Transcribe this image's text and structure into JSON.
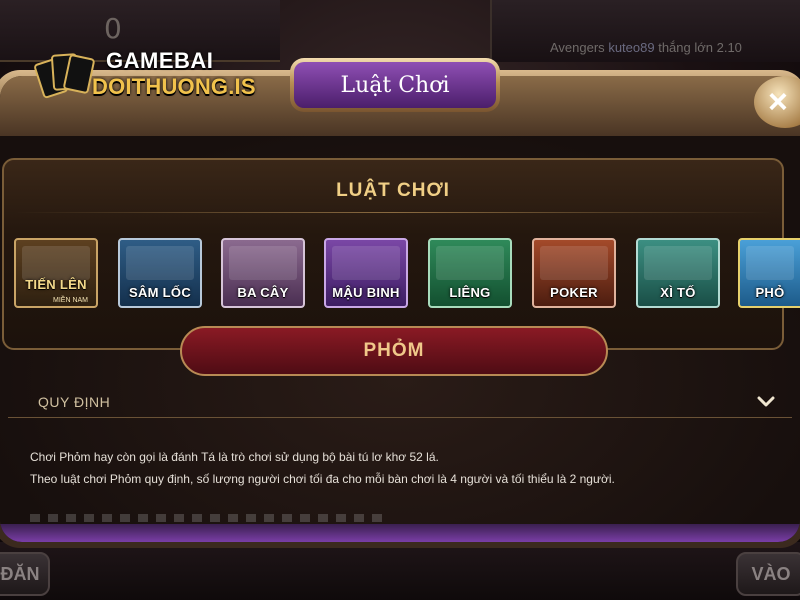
{
  "background": {
    "counter": "0",
    "ticker": {
      "user_prefix": "Avengers",
      "username": "kuteo89",
      "text": "thắng lớn 2.10"
    },
    "bottom_left_button": "ĐĂN",
    "bottom_right_button": "VÀO"
  },
  "logo": {
    "line1": "GAMEBAI",
    "line2": "DOITHUONG.IS"
  },
  "modal": {
    "title": "Luật Chơi",
    "close_label": "×",
    "selector_title": "LUẬT CHƠI",
    "games": [
      {
        "label": "TIẾN LÊN",
        "sublabel": "MIỀN NAM"
      },
      {
        "label": "SÂM LỐC"
      },
      {
        "label": "BA CÂY"
      },
      {
        "label": "MẬU BINH"
      },
      {
        "label": "LIÊNG"
      },
      {
        "label": "POKER"
      },
      {
        "label": "XÌ TỐ"
      },
      {
        "label": "PHỎ"
      }
    ],
    "selected_game": "PHỎM",
    "section_title": "QUY ĐỊNH",
    "rules": [
      "Chơi Phỏm hay còn gọi là đánh Tá là trò chơi sử dụng bộ bài tú lơ khơ 52 lá.",
      "Theo luật chơi Phỏm quy định, số lượng người chơi tối đa cho mỗi bàn chơi là 4 người và tối thiểu là 2 người."
    ]
  },
  "colors": {
    "title_plate": "#6a2f8c",
    "selected_pill": "#7a1520",
    "gold": "#f0cf86"
  },
  "icons": {
    "close": "close-icon",
    "chevron": "chevron-down-icon"
  }
}
